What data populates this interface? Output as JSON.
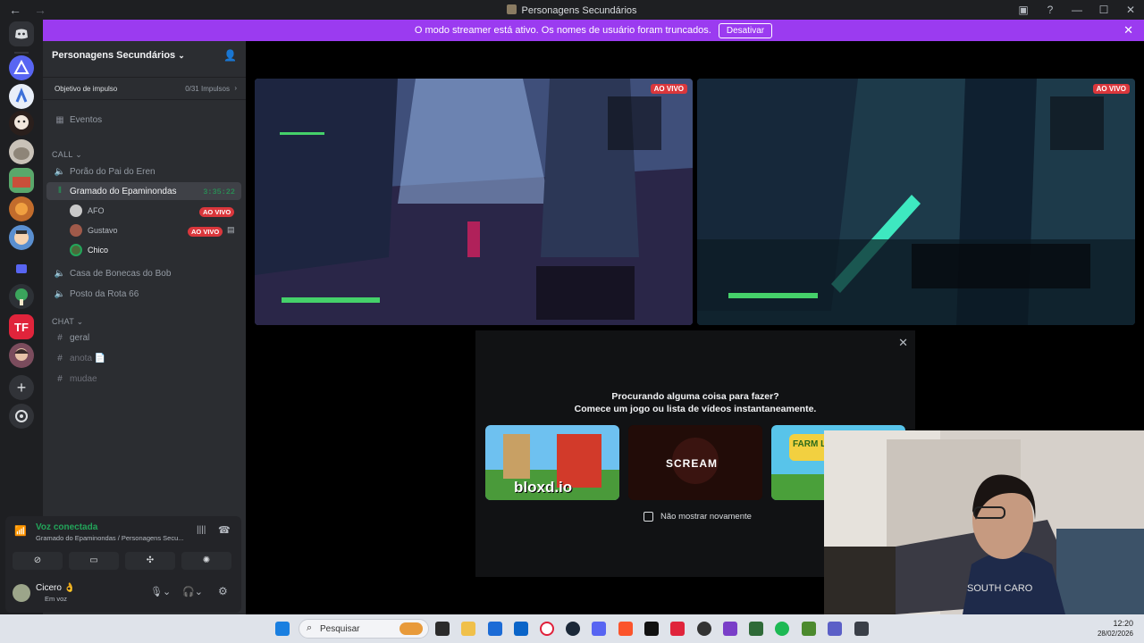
{
  "window": {
    "title": "Personagens Secundários",
    "back_icon": "←",
    "forward_icon": "→"
  },
  "banner": {
    "text": "O modo streamer está ativo. Os nomes de usuário foram truncados.",
    "button": "Desativar",
    "close": "✕"
  },
  "server": {
    "name": "Personagens Secundários",
    "boost_label": "Objetivo de impulso",
    "boost_count": "0/31 Impulsos",
    "events": "Eventos",
    "call_category": "CALL",
    "chat_category": "CHAT",
    "voice_channels": [
      {
        "name": "Porão do Pai do Eren"
      },
      {
        "name": "Gramado do Epaminondas",
        "timer": "3:35:22"
      },
      {
        "name": "Casa de Bonecas do Bob"
      },
      {
        "name": "Posto da Rota 66"
      }
    ],
    "users": [
      {
        "name": "AFO",
        "live": "AO VIVO"
      },
      {
        "name": "Gustavo",
        "live": "AO VIVO"
      },
      {
        "name": "Chico"
      }
    ],
    "text_channels": [
      {
        "name": "geral"
      },
      {
        "name": "anota 📄"
      },
      {
        "name": "mudae"
      }
    ]
  },
  "voice_panel": {
    "status": "Voz conectada",
    "location": "Gramado do Epaminondas / Personagens Secu...",
    "username": "Cicero 👌",
    "user_status": "Em voz"
  },
  "streams": [
    {
      "live": "AO VIVO"
    },
    {
      "live": "AO VIVO"
    }
  ],
  "activity_modal": {
    "line1": "Procurando alguma coisa para fazer?",
    "line2": "Comece um jogo ou lista de vídeos instantaneamente.",
    "cards": [
      "bloxd.io",
      "SCREAM",
      "FARM LAND"
    ],
    "checkbox_label": "Não mostrar novamente",
    "close": "✕"
  },
  "taskbar": {
    "search_placeholder": "Pesquisar",
    "time": "12:20",
    "date": "28/02/2026"
  },
  "colors": {
    "accent_purple": "#9b3bf0",
    "live_red": "#da373c",
    "voice_green": "#23a55a",
    "sidebar_bg": "#2b2d31",
    "rail_bg": "#1e1f22"
  }
}
